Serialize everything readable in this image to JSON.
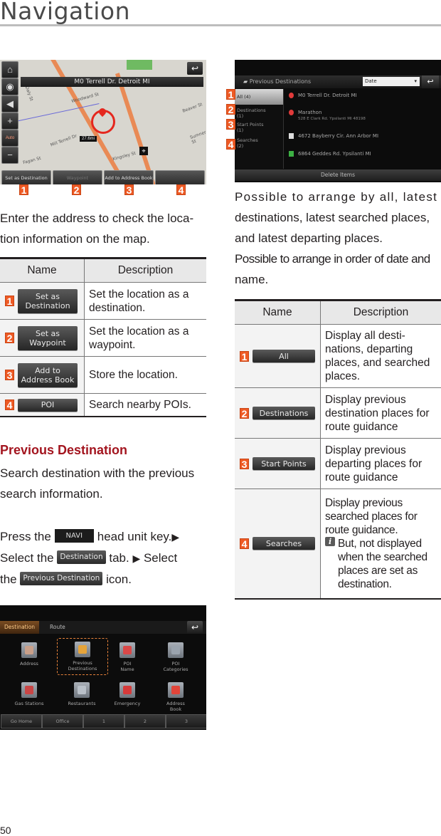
{
  "page": {
    "title": "Navigation",
    "number": "50"
  },
  "map_screen": {
    "address": "M0 Terrell Dr. Detroit MI",
    "distance": "27.6mi",
    "auto_label": "Auto",
    "streets": [
      "Woodward St",
      "Mill Terrell Dr",
      "Fagan St",
      "Beaver St",
      "Sumner St",
      "Kingsley St",
      "Daly St"
    ],
    "buttons": [
      {
        "label": "Set as Destination",
        "enabled": true
      },
      {
        "label": "Waypoint",
        "enabled": false
      },
      {
        "label": "Add to Address Book",
        "enabled": true
      },
      {
        "label": "",
        "enabled": true
      }
    ],
    "callouts": [
      "1",
      "2",
      "3",
      "4"
    ]
  },
  "intro": {
    "text": "Enter the address to check the location information on the map.",
    "line1": "Enter the address to check the loca-",
    "line2": "tion information on the map."
  },
  "table1": {
    "headers": [
      "Name",
      "Description"
    ],
    "rows": [
      {
        "num": "1",
        "button": "Set as Destination",
        "button_l1": "Set as",
        "button_l2": "Destination",
        "desc_l1": "Set the location as a",
        "desc_l2": "destination."
      },
      {
        "num": "2",
        "button": "Set as Waypoint",
        "button_l1": "Set as",
        "button_l2": "Waypoint",
        "desc_l1": "Set the location as a",
        "desc_l2": "waypoint."
      },
      {
        "num": "3",
        "button": "Add to Address Book",
        "button_l1": "Add to",
        "button_l2": "Address Book",
        "desc_l1": "Store the location.",
        "desc_l2": ""
      },
      {
        "num": "4",
        "button": "POI",
        "button_l1": "POI",
        "button_l2": "",
        "desc_l1": "Search nearby POIs.",
        "desc_l2": ""
      }
    ]
  },
  "previous_destination": {
    "heading": "Previous Destination",
    "desc_l1": "Search destination with the previous",
    "desc_l2": "search information.",
    "step": {
      "press_the": "Press the",
      "navi_key": "NAVI",
      "head_unit_key": "head unit key.",
      "arrow": "▶",
      "select_the": "Select the",
      "destination_tab": "Destination",
      "tab": "tab.",
      "select": "Select",
      "the": "the",
      "prev_dest_icon": "Previous Destination",
      "icon": "icon."
    }
  },
  "menu_screen": {
    "tabs": [
      "Destination",
      "Route"
    ],
    "active_tab": "Destination",
    "items": [
      {
        "label_l1": "Address",
        "label_l2": "",
        "icon": "house-icon"
      },
      {
        "label_l1": "Previous",
        "label_l2": "Destinations",
        "icon": "folder-icon",
        "selected": true
      },
      {
        "label_l1": "POI",
        "label_l2": "Name",
        "icon": "poi-search-icon"
      },
      {
        "label_l1": "POI",
        "label_l2": "Categories",
        "icon": "categories-icon"
      },
      {
        "label_l1": "Gas Stations",
        "label_l2": "",
        "icon": "gas-station-icon"
      },
      {
        "label_l1": "Restaurants",
        "label_l2": "",
        "icon": "restaurant-icon"
      },
      {
        "label_l1": "Emergency",
        "label_l2": "",
        "icon": "emergency-icon"
      },
      {
        "label_l1": "Address",
        "label_l2": "Book",
        "icon": "address-book-icon"
      }
    ],
    "bottom": [
      "Go Home",
      "Office",
      "1",
      "2",
      "3"
    ]
  },
  "prev_screen": {
    "title": "Previous Destinations",
    "sort": "Date",
    "categories": [
      {
        "num": "1",
        "label_l1": "All (4)",
        "label_l2": ""
      },
      {
        "num": "2",
        "label_l1": "Destinations",
        "label_l2": "(1)"
      },
      {
        "num": "3",
        "label_l1": "Start Points",
        "label_l2": "(1)"
      },
      {
        "num": "4",
        "label_l1": "Searches",
        "label_l2": "(2)"
      }
    ],
    "entries": [
      {
        "line1": "M0 Terrell Dr. Detroit MI",
        "line2": "",
        "icon": "red-pin"
      },
      {
        "line1": "Marathon",
        "line2": "528 E Clark Rd. Ypsilanti MI 48198",
        "icon": "red-pin"
      },
      {
        "line1": "4672 Bayberry Cir. Ann Arbor MI",
        "line2": "",
        "icon": "white-flag"
      },
      {
        "line1": "6864 Geddes Rd. Ypsilanti MI",
        "line2": "",
        "icon": "green-flag"
      }
    ],
    "delete": "Delete Items"
  },
  "sort_intro": {
    "l1": "Possible to arrange by all, latest",
    "l2": "destinations, latest searched places,",
    "l3": "and latest departing places.",
    "l4": "Possible to arrange in order of date and",
    "l5": "name."
  },
  "table2": {
    "headers": [
      "Name",
      "Description"
    ],
    "rows": [
      {
        "num": "1",
        "button": "All",
        "desc": [
          "Display all desti-",
          "nations, departing",
          "places, and searched",
          "places."
        ]
      },
      {
        "num": "2",
        "button": "Destinations",
        "desc": [
          "Display previous",
          "destination places for",
          "route guidance"
        ]
      },
      {
        "num": "3",
        "button": "Start Points",
        "desc": [
          "Display previous",
          "departing places for",
          "route guidance"
        ]
      },
      {
        "num": "4",
        "button": "Searches",
        "desc": [
          "Display previous",
          "searched places for",
          "route guidance."
        ],
        "note": [
          "But, not displayed",
          "when the searched",
          "places are set as",
          "destination."
        ]
      }
    ]
  },
  "colors": {
    "accent_red": "#a3151f",
    "badge_orange": "#ee5a24",
    "title_gray": "#4a4a4a"
  }
}
